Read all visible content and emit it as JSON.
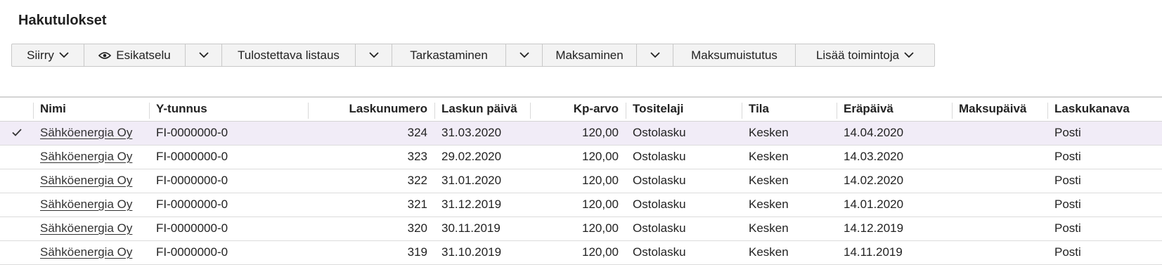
{
  "page_title": "Hakutulokset",
  "toolbar": {
    "siirry": "Siirry",
    "esikatselu": "Esikatselu",
    "tulostettava": "Tulostettava listaus",
    "tarkastaminen": "Tarkastaminen",
    "maksaminen": "Maksaminen",
    "maksumuistutus": "Maksumuistutus",
    "lisaa": "Lisää toimintoja"
  },
  "columns": {
    "nimi": "Nimi",
    "ytunnus": "Y-tunnus",
    "laskunumero": "Laskunumero",
    "laskunpaiva": "Laskun päivä",
    "kparvo": "Kp-arvo",
    "tositelaji": "Tositelaji",
    "tila": "Tila",
    "erapaiva": "Eräpäivä",
    "maksupaiva": "Maksupäivä",
    "laskukanava": "Laskukanava"
  },
  "rows": [
    {
      "selected": true,
      "nimi": "Sähköenergia Oy",
      "ytunnus": "FI-0000000-0",
      "laskunumero": "324",
      "laskunpaiva": "31.03.2020",
      "kparvo": "120,00",
      "tositelaji": "Ostolasku",
      "tila": "Kesken",
      "erapaiva": "14.04.2020",
      "maksupaiva": "",
      "laskukanava": "Posti"
    },
    {
      "selected": false,
      "nimi": "Sähköenergia Oy",
      "ytunnus": "FI-0000000-0",
      "laskunumero": "323",
      "laskunpaiva": "29.02.2020",
      "kparvo": "120,00",
      "tositelaji": "Ostolasku",
      "tila": "Kesken",
      "erapaiva": "14.03.2020",
      "maksupaiva": "",
      "laskukanava": "Posti"
    },
    {
      "selected": false,
      "nimi": "Sähköenergia Oy",
      "ytunnus": "FI-0000000-0",
      "laskunumero": "322",
      "laskunpaiva": "31.01.2020",
      "kparvo": "120,00",
      "tositelaji": "Ostolasku",
      "tila": "Kesken",
      "erapaiva": "14.02.2020",
      "maksupaiva": "",
      "laskukanava": "Posti"
    },
    {
      "selected": false,
      "nimi": "Sähköenergia Oy",
      "ytunnus": "FI-0000000-0",
      "laskunumero": "321",
      "laskunpaiva": "31.12.2019",
      "kparvo": "120,00",
      "tositelaji": "Ostolasku",
      "tila": "Kesken",
      "erapaiva": "14.01.2020",
      "maksupaiva": "",
      "laskukanava": "Posti"
    },
    {
      "selected": false,
      "nimi": "Sähköenergia Oy",
      "ytunnus": "FI-0000000-0",
      "laskunumero": "320",
      "laskunpaiva": "30.11.2019",
      "kparvo": "120,00",
      "tositelaji": "Ostolasku",
      "tila": "Kesken",
      "erapaiva": "14.12.2019",
      "maksupaiva": "",
      "laskukanava": "Posti"
    },
    {
      "selected": false,
      "nimi": "Sähköenergia Oy",
      "ytunnus": "FI-0000000-0",
      "laskunumero": "319",
      "laskunpaiva": "31.10.2019",
      "kparvo": "120,00",
      "tositelaji": "Ostolasku",
      "tila": "Kesken",
      "erapaiva": "14.11.2019",
      "maksupaiva": "",
      "laskukanava": "Posti"
    }
  ],
  "icons": {
    "selected": "check-icon",
    "dropdown": "chevron-down-icon",
    "preview": "eye-icon"
  }
}
